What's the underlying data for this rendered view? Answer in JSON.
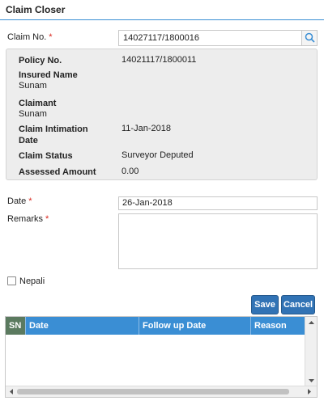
{
  "page": {
    "title": "Claim Closer"
  },
  "claim": {
    "label": "Claim No.",
    "required_mark": "*",
    "value": "14027117/1800016",
    "search_icon": "search-icon"
  },
  "info": {
    "policy_no_label": "Policy No.",
    "policy_no_value": "14021117/1800011",
    "insured_name_label": "Insured Name",
    "insured_name_value": "Sunam",
    "claimant_label": "Claimant",
    "claimant_value": "Sunam",
    "intimation_label_line1": "Claim Intimation",
    "intimation_label_line2": "Date",
    "intimation_value": "11-Jan-2018",
    "status_label": "Claim Status",
    "status_value": "Surveyor Deputed",
    "assessed_label": "Assessed Amount",
    "assessed_value": "0.00"
  },
  "form": {
    "date_label": "Date",
    "date_required": "*",
    "date_value": "26-Jan-2018",
    "remarks_label": "Remarks",
    "remarks_required": "*",
    "remarks_value": "",
    "nepali_label": "Nepali",
    "nepali_checked": false
  },
  "buttons": {
    "save": "Save",
    "cancel": "Cancel"
  },
  "grid": {
    "columns": [
      "SN",
      "Date",
      "Follow up Date",
      "Reason"
    ],
    "rows": []
  },
  "colors": {
    "accent": "#3a8ed4",
    "button": "#3173b5",
    "required": "#d9261c",
    "sn_header": "#5b7a5f"
  }
}
